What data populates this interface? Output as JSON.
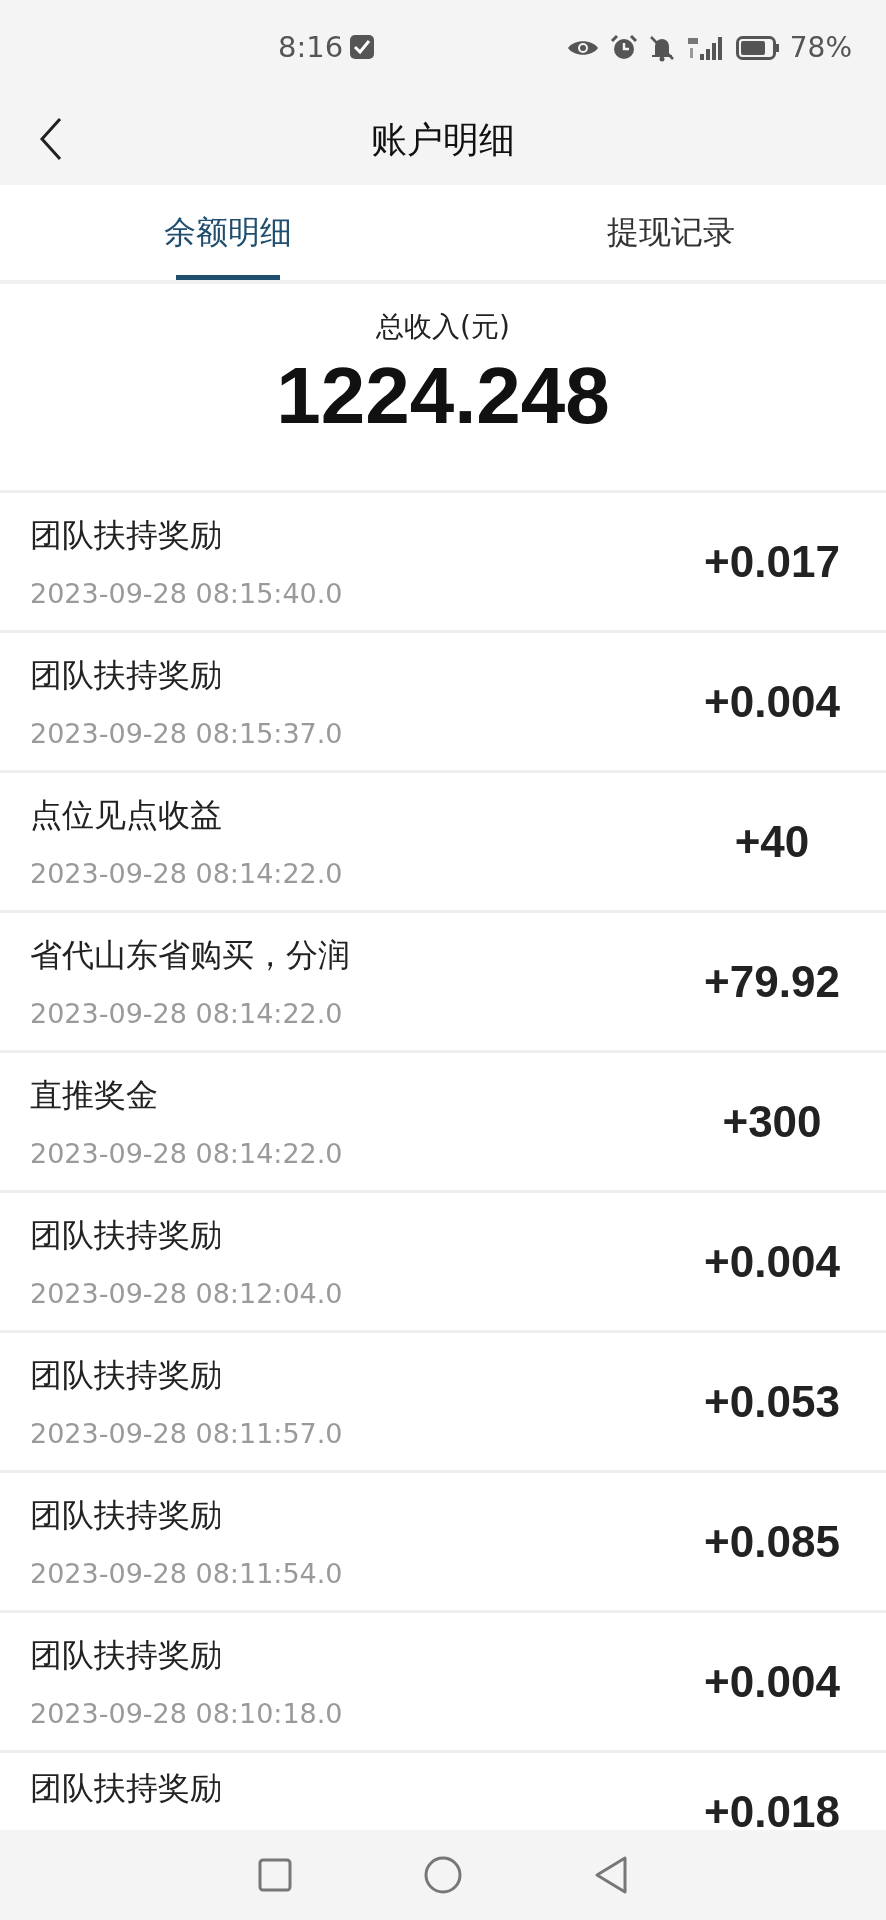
{
  "status_bar": {
    "time": "8:16",
    "battery": "78%"
  },
  "header": {
    "title": "账户明细"
  },
  "tabs": [
    {
      "label": "余额明细",
      "selected": true
    },
    {
      "label": "提现记录",
      "selected": false
    }
  ],
  "summary": {
    "label": "总收入(元)",
    "value": "1224.248"
  },
  "records": [
    {
      "title": "团队扶持奖励",
      "time": "2023-09-28 08:15:40.0",
      "amount": "+0.017"
    },
    {
      "title": "团队扶持奖励",
      "time": "2023-09-28 08:15:37.0",
      "amount": "+0.004"
    },
    {
      "title": "点位见点收益",
      "time": "2023-09-28 08:14:22.0",
      "amount": "+40"
    },
    {
      "title": "省代山东省购买，分润",
      "time": "2023-09-28 08:14:22.0",
      "amount": "+79.92"
    },
    {
      "title": "直推奖金",
      "time": "2023-09-28 08:14:22.0",
      "amount": "+300"
    },
    {
      "title": "团队扶持奖励",
      "time": "2023-09-28 08:12:04.0",
      "amount": "+0.004"
    },
    {
      "title": "团队扶持奖励",
      "time": "2023-09-28 08:11:57.0",
      "amount": "+0.053"
    },
    {
      "title": "团队扶持奖励",
      "time": "2023-09-28 08:11:54.0",
      "amount": "+0.085"
    },
    {
      "title": "团队扶持奖励",
      "time": "2023-09-28 08:10:18.0",
      "amount": "+0.004"
    },
    {
      "title": "团队扶持奖励",
      "amount": "+0.018"
    }
  ]
}
